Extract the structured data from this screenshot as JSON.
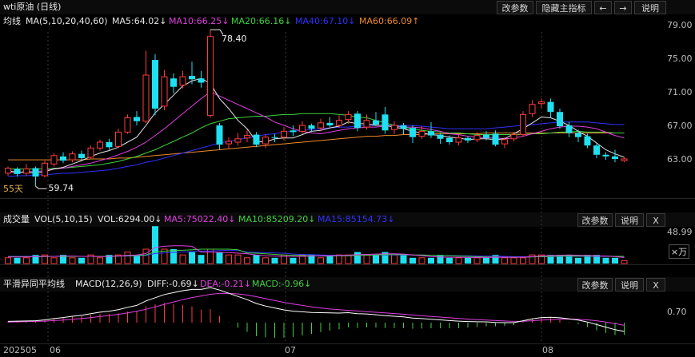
{
  "title_bar": {
    "title": "wti原油 (日线)",
    "buttons": [
      "改参数",
      "隐藏主指标",
      "←",
      "→",
      "说明"
    ]
  },
  "main_panel": {
    "indicator_name": "均线",
    "indicator_params": "MA(5,10,20,40,60)",
    "ma_values": [
      {
        "label": "MA5:64.02↓",
        "color": "#e6e6e6"
      },
      {
        "label": "MA10:66.25↓",
        "color": "#e23fe2"
      },
      {
        "label": "MA20:66.16↓",
        "color": "#3fd23f"
      },
      {
        "label": "MA40:67.10↓",
        "color": "#3030ff"
      },
      {
        "label": "MA60:66.09↑",
        "color": "#f08a2a"
      }
    ],
    "y_ticks": [
      "79.00",
      "75.00",
      "71.00",
      "67.00",
      "63.00"
    ],
    "high_label": "78.40",
    "low_label": "59.74",
    "days_label": "55天"
  },
  "volume_panel": {
    "name": "成交量",
    "params": "VOL(5,10,15)",
    "values": [
      {
        "label": "VOL:6294.00↓",
        "color": "#e6e6e6"
      },
      {
        "label": "MA5:75022.40↓",
        "color": "#e23fe2"
      },
      {
        "label": "MA10:85209.20↓",
        "color": "#3fd23f"
      },
      {
        "label": "MA15:85154.73↓",
        "color": "#3030ff"
      }
    ],
    "buttons": [
      "改参数",
      "说明",
      "X"
    ],
    "y_tick": "48.99",
    "unit": "×万"
  },
  "macd_panel": {
    "name": "平滑异同平均线",
    "params": "MACD(12,26,9)",
    "values": [
      {
        "label": "DIFF:-0.69↓",
        "color": "#e6e6e6"
      },
      {
        "label": "DEA:-0.21↓",
        "color": "#e23fe2"
      },
      {
        "label": "MACD:-0.96↓",
        "color": "#3fd23f"
      }
    ],
    "buttons": [
      "改参数",
      "说明",
      "X"
    ],
    "y_tick": "0.70"
  },
  "x_axis": [
    "202505",
    "06",
    "07",
    "08"
  ],
  "colors": {
    "up": "#ff3b3b",
    "down": "#1fe0f0",
    "ma5": "#e6e6e6",
    "ma10": "#e23fe2",
    "ma20": "#3fd23f",
    "ma40": "#3030ff",
    "ma60": "#f08a2a"
  },
  "chart_data": {
    "type": "candlestick",
    "y_range": [
      59.0,
      79.0
    ],
    "candles": [
      {
        "o": 61.3,
        "c": 61.9,
        "h": 62.1,
        "l": 61.0
      },
      {
        "o": 61.8,
        "c": 61.2,
        "h": 62.0,
        "l": 60.9
      },
      {
        "o": 61.3,
        "c": 61.8,
        "h": 62.4,
        "l": 61.0
      },
      {
        "o": 61.9,
        "c": 60.9,
        "h": 62.1,
        "l": 59.74
      },
      {
        "o": 61.0,
        "c": 62.5,
        "h": 62.8,
        "l": 60.8
      },
      {
        "o": 62.4,
        "c": 63.4,
        "h": 63.7,
        "l": 62.1
      },
      {
        "o": 63.3,
        "c": 62.8,
        "h": 63.8,
        "l": 62.5
      },
      {
        "o": 62.9,
        "c": 63.6,
        "h": 63.9,
        "l": 62.6
      },
      {
        "o": 63.6,
        "c": 63.1,
        "h": 64.0,
        "l": 62.8
      },
      {
        "o": 63.2,
        "c": 64.3,
        "h": 64.6,
        "l": 63.0
      },
      {
        "o": 64.3,
        "c": 65.0,
        "h": 65.3,
        "l": 64.0
      },
      {
        "o": 65.0,
        "c": 64.4,
        "h": 65.4,
        "l": 64.1
      },
      {
        "o": 64.5,
        "c": 66.2,
        "h": 66.6,
        "l": 64.3
      },
      {
        "o": 66.2,
        "c": 67.9,
        "h": 68.3,
        "l": 66.0
      },
      {
        "o": 68.0,
        "c": 67.5,
        "h": 68.7,
        "l": 67.0
      },
      {
        "o": 67.5,
        "c": 73.0,
        "h": 75.9,
        "l": 67.3
      },
      {
        "o": 74.8,
        "c": 69.0,
        "h": 75.5,
        "l": 68.2
      },
      {
        "o": 69.3,
        "c": 72.8,
        "h": 73.6,
        "l": 68.8
      },
      {
        "o": 72.6,
        "c": 71.6,
        "h": 73.2,
        "l": 70.8
      },
      {
        "o": 71.8,
        "c": 72.8,
        "h": 73.5,
        "l": 71.4
      },
      {
        "o": 72.9,
        "c": 72.5,
        "h": 74.6,
        "l": 71.9
      },
      {
        "o": 72.6,
        "c": 72.1,
        "h": 73.5,
        "l": 71.5
      },
      {
        "o": 68.2,
        "c": 77.6,
        "h": 78.4,
        "l": 67.9
      },
      {
        "o": 67.0,
        "c": 64.7,
        "h": 67.3,
        "l": 64.1
      },
      {
        "o": 64.8,
        "c": 65.1,
        "h": 65.6,
        "l": 64.2
      },
      {
        "o": 65.0,
        "c": 65.4,
        "h": 66.1,
        "l": 64.6
      },
      {
        "o": 65.5,
        "c": 65.8,
        "h": 66.5,
        "l": 65.0
      },
      {
        "o": 65.9,
        "c": 64.7,
        "h": 66.2,
        "l": 64.4
      },
      {
        "o": 64.8,
        "c": 65.6,
        "h": 65.9,
        "l": 64.3
      },
      {
        "o": 65.6,
        "c": 65.5,
        "h": 66.0,
        "l": 65.0
      },
      {
        "o": 65.6,
        "c": 66.3,
        "h": 66.8,
        "l": 65.2
      },
      {
        "o": 66.4,
        "c": 66.2,
        "h": 67.0,
        "l": 65.7
      },
      {
        "o": 66.3,
        "c": 67.0,
        "h": 67.5,
        "l": 66.0
      },
      {
        "o": 67.0,
        "c": 66.6,
        "h": 67.2,
        "l": 66.2
      },
      {
        "o": 66.7,
        "c": 67.3,
        "h": 67.8,
        "l": 66.3
      },
      {
        "o": 67.3,
        "c": 67.0,
        "h": 68.0,
        "l": 66.8
      },
      {
        "o": 67.0,
        "c": 67.6,
        "h": 68.2,
        "l": 66.7
      },
      {
        "o": 67.7,
        "c": 68.3,
        "h": 68.7,
        "l": 67.2
      },
      {
        "o": 68.4,
        "c": 66.7,
        "h": 68.7,
        "l": 66.3
      },
      {
        "o": 66.8,
        "c": 67.6,
        "h": 68.3,
        "l": 66.5
      },
      {
        "o": 67.6,
        "c": 67.1,
        "h": 68.6,
        "l": 66.9
      },
      {
        "o": 68.3,
        "c": 66.4,
        "h": 69.2,
        "l": 66.0
      },
      {
        "o": 66.5,
        "c": 67.0,
        "h": 67.5,
        "l": 66.0
      },
      {
        "o": 67.0,
        "c": 66.6,
        "h": 67.3,
        "l": 65.9
      },
      {
        "o": 66.7,
        "c": 65.6,
        "h": 67.0,
        "l": 64.9
      },
      {
        "o": 65.7,
        "c": 66.3,
        "h": 66.9,
        "l": 65.4
      },
      {
        "o": 66.3,
        "c": 65.8,
        "h": 67.4,
        "l": 65.5
      },
      {
        "o": 65.9,
        "c": 65.4,
        "h": 66.1,
        "l": 64.8
      },
      {
        "o": 65.5,
        "c": 65.0,
        "h": 65.8,
        "l": 64.7
      },
      {
        "o": 65.0,
        "c": 65.5,
        "h": 65.9,
        "l": 64.6
      },
      {
        "o": 65.5,
        "c": 65.2,
        "h": 65.7,
        "l": 64.9
      },
      {
        "o": 65.3,
        "c": 65.8,
        "h": 66.2,
        "l": 65.0
      },
      {
        "o": 65.9,
        "c": 65.5,
        "h": 66.3,
        "l": 65.2
      },
      {
        "o": 66.0,
        "c": 64.7,
        "h": 66.4,
        "l": 64.5
      },
      {
        "o": 64.8,
        "c": 65.3,
        "h": 65.6,
        "l": 64.3
      },
      {
        "o": 65.4,
        "c": 65.9,
        "h": 66.2,
        "l": 65.1
      },
      {
        "o": 65.9,
        "c": 68.3,
        "h": 68.7,
        "l": 65.7
      },
      {
        "o": 68.4,
        "c": 69.5,
        "h": 70.0,
        "l": 68.0
      },
      {
        "o": 69.6,
        "c": 69.8,
        "h": 70.2,
        "l": 69.1
      },
      {
        "o": 69.8,
        "c": 68.6,
        "h": 70.2,
        "l": 67.9
      },
      {
        "o": 68.6,
        "c": 66.9,
        "h": 69.0,
        "l": 66.6
      },
      {
        "o": 67.0,
        "c": 66.1,
        "h": 67.4,
        "l": 65.6
      },
      {
        "o": 66.1,
        "c": 65.6,
        "h": 66.5,
        "l": 65.0
      },
      {
        "o": 65.7,
        "c": 64.6,
        "h": 66.0,
        "l": 64.3
      },
      {
        "o": 64.6,
        "c": 63.5,
        "h": 64.9,
        "l": 63.1
      },
      {
        "o": 63.5,
        "c": 63.3,
        "h": 63.8,
        "l": 62.9
      },
      {
        "o": 63.3,
        "c": 63.0,
        "h": 64.1,
        "l": 62.6
      },
      {
        "o": 62.8,
        "c": 63.0,
        "h": 63.2,
        "l": 62.6
      }
    ],
    "ma5": [
      61.6,
      61.4,
      61.4,
      61.3,
      61.5,
      61.8,
      62.0,
      62.4,
      62.8,
      63.3,
      63.7,
      64.0,
      64.4,
      65.0,
      65.6,
      67.0,
      68.5,
      69.5,
      70.6,
      71.7,
      72.3,
      72.6,
      72.0,
      70.2,
      69.0,
      67.6,
      66.6,
      65.1,
      65.0,
      65.4,
      65.5,
      65.5,
      65.9,
      66.3,
      66.4,
      66.7,
      66.9,
      67.4,
      67.2,
      67.2,
      67.0,
      67.0,
      66.8,
      66.6,
      66.3,
      66.1,
      65.9,
      65.8,
      65.6,
      65.5,
      65.3,
      65.4,
      65.4,
      65.3,
      65.4,
      66.0,
      66.6,
      67.3,
      68.0,
      67.9,
      67.5,
      67.0,
      66.3,
      65.7,
      64.9,
      64.1,
      63.6,
      63.2
    ],
    "ma10": [
      61.4,
      61.4,
      61.5,
      61.5,
      61.6,
      61.8,
      61.9,
      62.1,
      62.3,
      62.5,
      62.8,
      63.1,
      63.5,
      63.9,
      64.4,
      65.0,
      65.8,
      66.6,
      67.5,
      68.4,
      69.3,
      70.2,
      71.0,
      70.5,
      70.0,
      69.5,
      69.0,
      68.5,
      68.0,
      67.4,
      67.0,
      66.6,
      66.3,
      66.1,
      66.0,
      66.2,
      66.4,
      66.6,
      66.7,
      66.8,
      66.8,
      66.9,
      66.9,
      66.8,
      66.8,
      66.7,
      66.5,
      66.3,
      66.0,
      65.9,
      65.7,
      65.6,
      65.5,
      65.5,
      65.4,
      65.5,
      65.7,
      66.0,
      66.3,
      66.6,
      66.8,
      66.9,
      66.9,
      66.8,
      66.6,
      66.2,
      65.8,
      65.5
    ],
    "ma20": [
      61.8,
      61.8,
      61.8,
      61.8,
      61.8,
      61.9,
      61.9,
      62.0,
      62.1,
      62.2,
      62.3,
      62.5,
      62.7,
      63.0,
      63.3,
      63.7,
      64.1,
      64.6,
      65.1,
      65.6,
      66.1,
      66.7,
      67.2,
      67.5,
      67.8,
      67.9,
      68.0,
      68.1,
      68.1,
      68.2,
      68.3,
      68.3,
      68.4,
      68.4,
      68.4,
      68.4,
      68.3,
      68.2,
      68.0,
      67.9,
      67.6,
      67.3,
      67.0,
      66.8,
      66.6,
      66.4,
      66.3,
      66.2,
      66.1,
      66.1,
      66.0,
      65.9,
      65.9,
      65.9,
      65.9,
      65.9,
      65.9,
      66.0,
      66.0,
      66.1,
      66.2,
      66.2,
      66.3,
      66.2,
      66.2,
      66.2,
      66.1,
      66.1
    ],
    "ma40": [
      60.9,
      61.0,
      61.0,
      61.1,
      61.1,
      61.2,
      61.3,
      61.3,
      61.4,
      61.5,
      61.6,
      61.7,
      61.9,
      62.1,
      62.3,
      62.6,
      62.8,
      63.1,
      63.4,
      63.7,
      64.0,
      64.3,
      64.6,
      64.9,
      65.1,
      65.3,
      65.5,
      65.7,
      65.9,
      66.0,
      66.2,
      66.3,
      66.4,
      66.5,
      66.6,
      66.7,
      66.8,
      66.8,
      66.9,
      67.0,
      67.0,
      67.0,
      67.0,
      67.0,
      67.0,
      66.9,
      66.8,
      66.7,
      66.6,
      66.6,
      66.6,
      66.6,
      66.6,
      66.7,
      66.8,
      66.9,
      67.0,
      67.1,
      67.2,
      67.3,
      67.4,
      67.4,
      67.4,
      67.4,
      67.3,
      67.2,
      67.1,
      67.1
    ],
    "ma60": [
      62.9,
      62.9,
      62.9,
      62.9,
      62.9,
      62.9,
      62.9,
      62.9,
      62.9,
      63.0,
      63.0,
      63.0,
      63.1,
      63.1,
      63.2,
      63.3,
      63.4,
      63.5,
      63.6,
      63.7,
      63.8,
      63.9,
      64.0,
      64.1,
      64.2,
      64.3,
      64.4,
      64.5,
      64.6,
      64.7,
      64.8,
      64.9,
      65.0,
      65.1,
      65.2,
      65.3,
      65.4,
      65.5,
      65.6,
      65.7,
      65.7,
      65.8,
      65.8,
      65.9,
      65.9,
      65.9,
      66.0,
      66.0,
      66.0,
      66.0,
      66.0,
      66.0,
      66.1,
      66.1,
      66.1,
      66.1,
      66.1,
      66.1,
      66.1,
      66.1,
      66.1,
      66.1,
      66.1,
      66.1,
      66.1,
      66.1,
      66.1,
      66.1
    ],
    "volume": [
      2,
      2,
      2,
      3,
      3,
      2,
      3,
      2,
      2,
      3,
      2,
      3,
      3,
      4,
      3,
      5,
      13,
      5,
      5,
      3,
      4,
      3,
      5,
      4,
      3,
      3,
      2,
      3,
      2,
      2,
      3,
      2,
      3,
      3,
      2,
      3,
      3,
      3,
      4,
      3,
      3,
      4,
      3,
      3,
      2,
      2,
      2,
      3,
      2,
      2,
      2,
      2,
      2,
      3,
      2,
      2,
      2,
      3,
      3,
      3,
      3,
      3,
      2,
      3,
      3,
      2,
      2,
      1
    ],
    "volume_ma5": [
      2.3,
      2.3,
      2.3,
      2.4,
      2.5,
      2.5,
      2.6,
      2.6,
      2.5,
      2.5,
      2.4,
      2.5,
      2.6,
      2.9,
      3.0,
      3.5,
      5.6,
      6.0,
      6.2,
      6.2,
      6.0,
      4.0,
      4.0,
      3.9,
      3.8,
      3.6,
      3.4,
      3.0,
      2.7,
      2.6,
      2.5,
      2.5,
      2.5,
      2.6,
      2.7,
      2.7,
      2.8,
      2.9,
      3.1,
      3.2,
      3.3,
      3.4,
      3.4,
      3.3,
      3.0,
      2.7,
      2.4,
      2.3,
      2.2,
      2.2,
      2.1,
      2.1,
      2.1,
      2.2,
      2.2,
      2.2,
      2.2,
      2.4,
      2.6,
      2.8,
      2.9,
      3.0,
      2.9,
      2.8,
      2.7,
      2.6,
      2.4,
      2.1
    ],
    "volume_ma10": [
      2.4,
      2.4,
      2.4,
      2.4,
      2.4,
      2.5,
      2.5,
      2.5,
      2.5,
      2.5,
      2.5,
      2.5,
      2.6,
      2.7,
      2.8,
      3.0,
      4.1,
      4.3,
      4.5,
      4.6,
      4.8,
      5.0,
      5.0,
      5.0,
      5.0,
      4.8,
      3.7,
      3.6,
      3.4,
      3.2,
      3.0,
      2.9,
      2.8,
      2.7,
      2.6,
      2.6,
      2.7,
      2.7,
      2.8,
      2.9,
      3.0,
      3.1,
      3.1,
      3.1,
      3.0,
      3.0,
      2.9,
      2.8,
      2.7,
      2.6,
      2.5,
      2.4,
      2.3,
      2.3,
      2.2,
      2.2,
      2.2,
      2.3,
      2.4,
      2.5,
      2.6,
      2.6,
      2.6,
      2.6,
      2.6,
      2.6,
      2.5,
      2.5
    ],
    "volume_ma15": [
      2.5,
      2.5,
      2.5,
      2.5,
      2.5,
      2.5,
      2.5,
      2.5,
      2.5,
      2.5,
      2.5,
      2.5,
      2.6,
      2.6,
      2.7,
      2.8,
      3.5,
      3.7,
      3.9,
      4.0,
      4.2,
      4.3,
      4.4,
      4.5,
      4.6,
      4.6,
      4.0,
      3.9,
      3.8,
      3.7,
      3.6,
      3.3,
      3.2,
      3.1,
      3.0,
      2.9,
      2.9,
      2.9,
      2.9,
      2.9,
      3.0,
      3.0,
      3.0,
      3.0,
      3.0,
      2.9,
      2.9,
      2.8,
      2.8,
      2.7,
      2.7,
      2.6,
      2.6,
      2.5,
      2.5,
      2.4,
      2.4,
      2.4,
      2.4,
      2.4,
      2.5,
      2.5,
      2.5,
      2.5,
      2.5,
      2.5,
      2.5,
      2.4
    ],
    "volume_y_max": 48.99,
    "macd_diff": [
      0.1,
      0.12,
      0.13,
      0.15,
      0.22,
      0.32,
      0.4,
      0.5,
      0.58,
      0.7,
      0.82,
      0.9,
      1.02,
      1.2,
      1.35,
      1.7,
      1.95,
      2.2,
      2.35,
      2.5,
      2.6,
      2.6,
      2.75,
      2.55,
      2.3,
      2.05,
      1.8,
      1.5,
      1.3,
      1.15,
      1.0,
      0.9,
      0.85,
      0.8,
      0.78,
      0.76,
      0.75,
      0.78,
      0.7,
      0.68,
      0.62,
      0.55,
      0.5,
      0.45,
      0.36,
      0.32,
      0.27,
      0.22,
      0.16,
      0.12,
      0.09,
      0.07,
      0.06,
      0.02,
      0.0,
      0.0,
      0.15,
      0.3,
      0.4,
      0.42,
      0.38,
      0.3,
      0.2,
      0.05,
      -0.15,
      -0.35,
      -0.55,
      -0.69
    ],
    "macd_dea": [
      0.05,
      0.06,
      0.08,
      0.1,
      0.12,
      0.16,
      0.2,
      0.26,
      0.32,
      0.39,
      0.48,
      0.56,
      0.65,
      0.77,
      0.89,
      1.05,
      1.23,
      1.43,
      1.62,
      1.8,
      1.96,
      2.09,
      2.22,
      2.29,
      2.29,
      2.25,
      2.16,
      2.03,
      1.88,
      1.74,
      1.59,
      1.46,
      1.35,
      1.24,
      1.15,
      1.07,
      1.01,
      0.96,
      0.91,
      0.86,
      0.81,
      0.76,
      0.71,
      0.66,
      0.6,
      0.55,
      0.49,
      0.44,
      0.38,
      0.33,
      0.28,
      0.24,
      0.2,
      0.16,
      0.13,
      0.1,
      0.11,
      0.15,
      0.2,
      0.24,
      0.27,
      0.28,
      0.26,
      0.22,
      0.15,
      0.05,
      -0.07,
      -0.21
    ],
    "macd_y_tick": 0.7
  }
}
